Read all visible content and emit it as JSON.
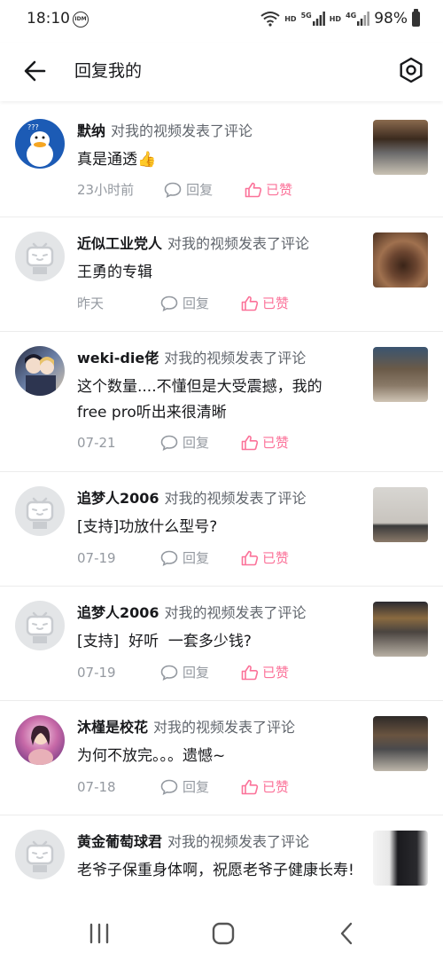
{
  "status_bar": {
    "time": "18:10",
    "idm_icon": "IDM",
    "hd1": "HD",
    "net1": "5G",
    "hd2": "HD",
    "net2": "4G",
    "battery_percent": "98%"
  },
  "header": {
    "title": "回复我的",
    "back_icon": "arrow-left-icon",
    "settings_icon": "hexagon-settings-icon"
  },
  "action_text": "对我的视频发表了评论",
  "reply_label": "回复",
  "liked_label": "已赞",
  "colors": {
    "accent_pink": "#fb7299",
    "muted": "#9499a0",
    "text": "#18191c"
  },
  "items": [
    {
      "username": "默纳",
      "comment": "真是通透👍",
      "time": "23小时前"
    },
    {
      "username": "近似工业党人",
      "comment": "王勇的专辑",
      "time": "昨天"
    },
    {
      "username": "weki-die佬",
      "comment": "这个数量....不懂但是大受震撼，我的free pro听出来很清晰",
      "time": "07-21"
    },
    {
      "username": "追梦人2006",
      "comment": "[支持]功放什么型号?",
      "time": "07-19"
    },
    {
      "username": "追梦人2006",
      "comment": "[支持]  好听  一套多少钱?",
      "time": "07-19"
    },
    {
      "username": "沐槿是校花",
      "comment": "为何不放完。。。遗憾~",
      "time": "07-18"
    },
    {
      "username": "黄金葡萄球君",
      "comment": "老爷子保重身体啊，祝愿老爷子健康长寿!",
      "time": ""
    }
  ],
  "nav": {
    "recents_icon": "recents-icon",
    "home_icon": "home-icon",
    "back_icon": "nav-back-icon"
  }
}
